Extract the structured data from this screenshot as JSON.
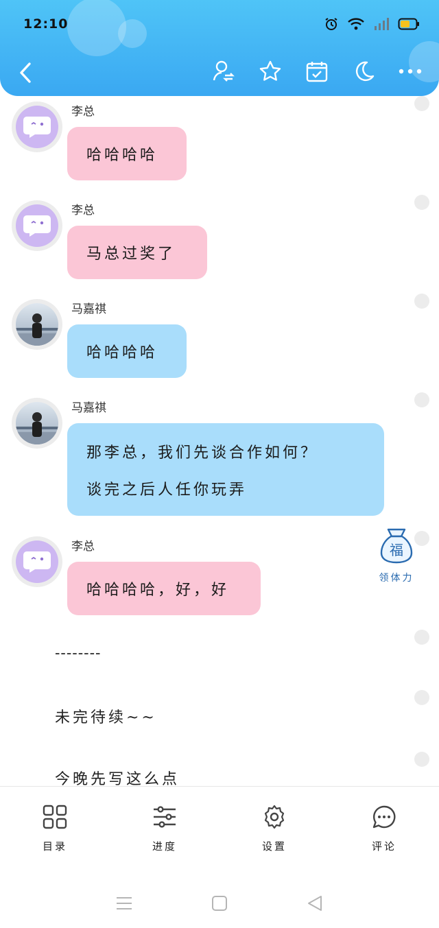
{
  "status_bar": {
    "time": "12:10"
  },
  "colors": {
    "header": "#3aa8f2",
    "pink_bubble": "#fbc6d6",
    "blue_bubble": "#a9ddfb"
  },
  "header": {
    "icons": [
      "back-icon",
      "author-switch-icon",
      "star-icon",
      "calendar-check-icon",
      "night-mode-icon",
      "more-icon"
    ]
  },
  "messages": [
    {
      "sender": "李总",
      "lines": [
        "哈哈哈哈"
      ],
      "color": "pink",
      "avatar": "purple"
    },
    {
      "sender": "李总",
      "lines": [
        "马总过奖了"
      ],
      "color": "pink",
      "avatar": "purple"
    },
    {
      "sender": "马嘉祺",
      "lines": [
        "哈哈哈哈"
      ],
      "color": "blue",
      "avatar": "photo"
    },
    {
      "sender": "马嘉祺",
      "lines": [
        "那李总，我们先谈合作如何？",
        "谈完之后人任你玩弄"
      ],
      "color": "blue",
      "avatar": "photo"
    },
    {
      "sender": "李总",
      "lines": [
        "哈哈哈哈，好，好"
      ],
      "color": "pink",
      "avatar": "purple"
    }
  ],
  "plain_text": {
    "divider": "--------",
    "to_be_continued": "未完待续~~",
    "tonight": "今晚先写这么点"
  },
  "fu_widget": {
    "glyph": "福",
    "label": "领体力"
  },
  "bottom_tabs": [
    {
      "label": "目录",
      "icon": "grid-icon"
    },
    {
      "label": "进度",
      "icon": "sliders-icon"
    },
    {
      "label": "设置",
      "icon": "gear-icon"
    },
    {
      "label": "评论",
      "icon": "comment-icon"
    }
  ]
}
